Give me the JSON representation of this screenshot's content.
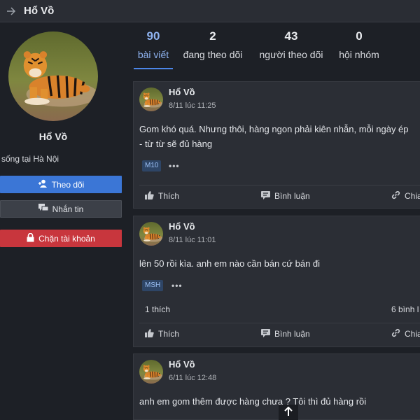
{
  "header": {
    "title": "Hổ Vồ"
  },
  "profile": {
    "name": "Hổ Vồ",
    "location": "sống tại Hà Nội",
    "follow_label": "Theo dõi",
    "message_label": "Nhắn tin",
    "block_label": "Chặn tài khoản"
  },
  "stats": [
    {
      "value": "90",
      "label": "bài viết",
      "active": true
    },
    {
      "value": "2",
      "label": "đang theo dõi"
    },
    {
      "value": "43",
      "label": "người theo dõi"
    },
    {
      "value": "0",
      "label": "hội nhóm"
    }
  ],
  "posts": [
    {
      "author": "Hổ Vồ",
      "time": "8/11 lúc 11:25",
      "text_line1": "Gom khó quá. Nhưng thôi, hàng ngon phải kiên nhẫn, mỗi ngày ép",
      "text_line2": "- từ từ sẽ đủ hàng",
      "tag": "M10",
      "more": "•••",
      "like_label": "Thích",
      "comment_label": "Bình luận",
      "share_label": "Chia"
    },
    {
      "author": "Hổ Vồ",
      "time": "8/11 lúc 11:01",
      "text_line1": "lên 50 rồi kìa. anh em nào cần bán cứ bán đi",
      "tag": "MSH",
      "more": "•••",
      "likes": "1 thích",
      "comments": "6 bình l",
      "like_label": "Thích",
      "comment_label": "Bình luận",
      "share_label": "Chia"
    },
    {
      "author": "Hổ Vồ",
      "time": "6/11 lúc 12:48",
      "text_line1": "anh em gom thêm được hàng chưa ? Tôi thì đủ hàng rồi"
    }
  ],
  "icons": {
    "back": "arrow-right-icon",
    "follow": "user-plus-icon",
    "message": "chat-icon",
    "block": "lock-icon",
    "like": "thumbs-up-icon",
    "comment": "comment-icon",
    "share": "link-icon",
    "scroll_top": "arrow-up-icon"
  },
  "colors": {
    "accent": "#3b76d6",
    "danger": "#c8363d",
    "active_stat": "#8fb3f0",
    "background": "#1d2026",
    "card": "#2b2e35"
  }
}
